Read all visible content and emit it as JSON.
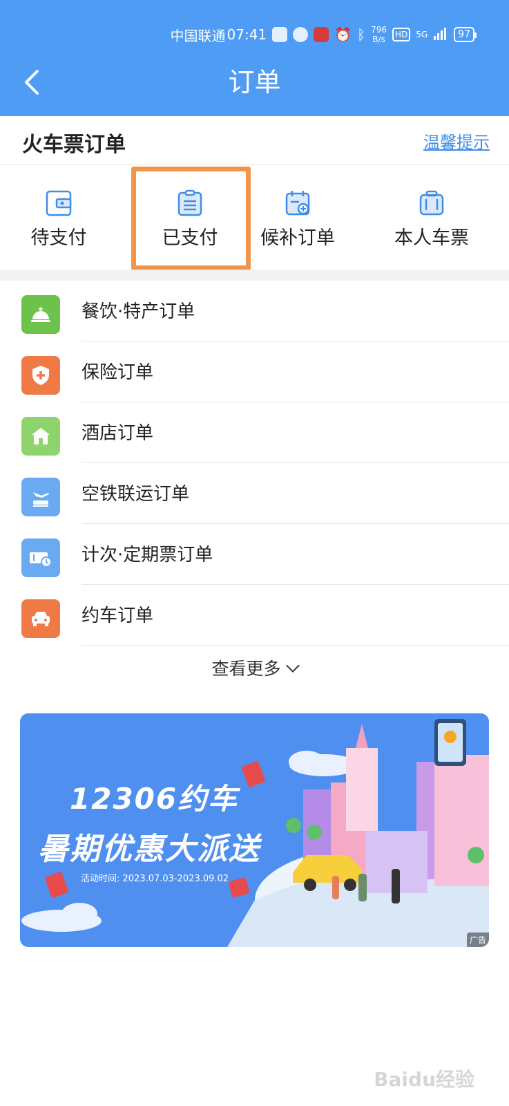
{
  "status_bar": {
    "carrier": "中国联通",
    "time": "07:41",
    "net_speed_value": "796",
    "net_speed_unit": "B/s",
    "hd": "HD",
    "signal": "5G",
    "battery": "97"
  },
  "header": {
    "title": "订单",
    "back_icon": "chevron-left-icon"
  },
  "train_orders": {
    "title": "火车票订单",
    "tip_link": "温馨提示",
    "tabs": [
      {
        "label": "待支付",
        "icon": "wallet-icon",
        "selected": false
      },
      {
        "label": "已支付",
        "icon": "clipboard-icon",
        "selected": true
      },
      {
        "label": "候补订单",
        "icon": "calendar-add-icon",
        "selected": false
      },
      {
        "label": "本人车票",
        "icon": "luggage-icon",
        "selected": false
      }
    ],
    "highlight_color": "#f0954a"
  },
  "other_orders": [
    {
      "label": "餐饮·特产订单",
      "icon": "dining-bell-icon",
      "color": "#6cc24a"
    },
    {
      "label": "保险订单",
      "icon": "shield-plus-icon",
      "color": "#f07a45"
    },
    {
      "label": "酒店订单",
      "icon": "hotel-icon",
      "color": "#8ed36b"
    },
    {
      "label": "空铁联运订单",
      "icon": "plane-train-icon",
      "color": "#6aaaf2"
    },
    {
      "label": "计次·定期票订单",
      "icon": "ticket-clock-icon",
      "color": "#6aaaf2"
    },
    {
      "label": "约车订单",
      "icon": "car-icon",
      "color": "#f07a45"
    }
  ],
  "more": {
    "label": "查看更多",
    "icon": "chevron-down-icon"
  },
  "banner": {
    "title_line1": "12306约车",
    "title_line2": "暑期优惠大派送",
    "activity_date": "活动时间: 2023.07.03-2023.09.02",
    "ad_label": "广告"
  },
  "watermark": "Baidu经验",
  "colors": {
    "header_bg": "#4f9cf5",
    "link": "#3d8ee8",
    "icon_blue": "#3f8ee6"
  }
}
